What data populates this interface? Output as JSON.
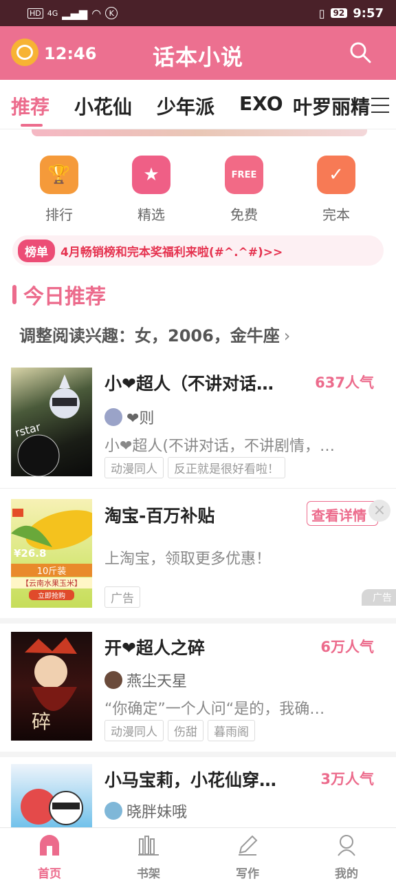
{
  "status_bar": {
    "left_tags": "HD",
    "network": "4G",
    "carrier_icon": "K",
    "battery": "92",
    "time": "9:57"
  },
  "header": {
    "clock": "12:46",
    "title": "话本小说"
  },
  "tabs": [
    {
      "label": "推荐",
      "active": true
    },
    {
      "label": "小花仙"
    },
    {
      "label": "少年派"
    },
    {
      "label": "EXO"
    },
    {
      "label": "叶罗丽精"
    }
  ],
  "quick_links": [
    {
      "label": "排行",
      "icon": "trophy-icon",
      "color": "#f59a3a"
    },
    {
      "label": "精选",
      "icon": "star-icon",
      "color": "#ef5f86"
    },
    {
      "label": "免费",
      "icon": "free-sign-icon",
      "color": "#f26a86"
    },
    {
      "label": "完本",
      "icon": "checklist-icon",
      "color": "#f77a55"
    }
  ],
  "notice": {
    "badge": "榜单",
    "text": "4月畅销榜和完本奖福利来啦(#^.^#)>>"
  },
  "section": {
    "title": "今日推荐"
  },
  "interest": {
    "text": "调整阅读兴趣：女，2006，金牛座",
    "chevron": "›"
  },
  "items": [
    {
      "title": "小❤超人（不讲对话…",
      "popularity": "637人气",
      "author": "❤则",
      "desc": "小❤超人(不讲对话，不讲剧情，…",
      "tags": [
        "动漫同人",
        "反正就是很好看啦！"
      ]
    },
    {
      "title": "淘宝-百万补贴",
      "button": "查看详情",
      "desc": "上淘宝，领取更多优惠！",
      "tags": [
        "广告"
      ],
      "ad_mark": "广告",
      "cover_price": "¥26.8",
      "cover_weight": "10斤装",
      "cover_name": "【云南水果玉米】",
      "cover_cta": "立即抢购"
    },
    {
      "title": "开❤超人之碎",
      "popularity": "6万人气",
      "author": "燕尘天星",
      "desc": "“你确定”一个人问“是的，我确…",
      "tags": [
        "动漫同人",
        "伤甜",
        "暮雨阁"
      ]
    },
    {
      "title": "小马宝莉，小花仙穿…",
      "popularity": "3万人气",
      "author": "晓胖妹哦"
    }
  ],
  "bottom_nav": [
    {
      "label": "首页",
      "icon": "home-icon",
      "active": true
    },
    {
      "label": "书架",
      "icon": "bookshelf-icon"
    },
    {
      "label": "写作",
      "icon": "pen-icon"
    },
    {
      "label": "我的",
      "icon": "profile-icon"
    }
  ],
  "colors": {
    "brand_pink": "#ec6b8c",
    "status_bar": "#4a2129"
  }
}
